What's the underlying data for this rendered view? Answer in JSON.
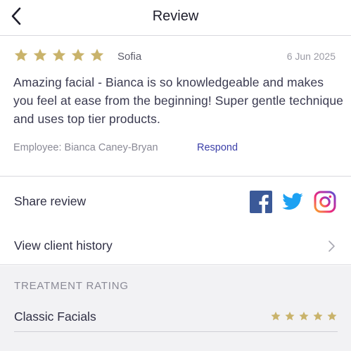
{
  "header": {
    "title": "Review"
  },
  "review": {
    "rating": 5,
    "reviewer": "Sofia",
    "date": "6 Jun 2025",
    "text": "Amazing facial - Bianca is so knowledgeable and makes you feel at ease from the beginning! Super gentle technique and uses top tier products.",
    "employee": "Employee: Bianca Caney-Bryan",
    "respond_label": "Respond"
  },
  "share": {
    "label": "Share review",
    "networks": [
      "facebook-icon",
      "twitter-icon",
      "instagram-icon"
    ]
  },
  "history": {
    "label": "View client history"
  },
  "treatment_rating": {
    "heading": "TREATMENT RATING",
    "items": [
      {
        "name": "Classic Facials",
        "rating": 5
      }
    ]
  },
  "colors": {
    "star": "#c9b36b",
    "link": "#3b3fa8",
    "facebook": "#3b5998",
    "twitter": "#1da1f2"
  }
}
